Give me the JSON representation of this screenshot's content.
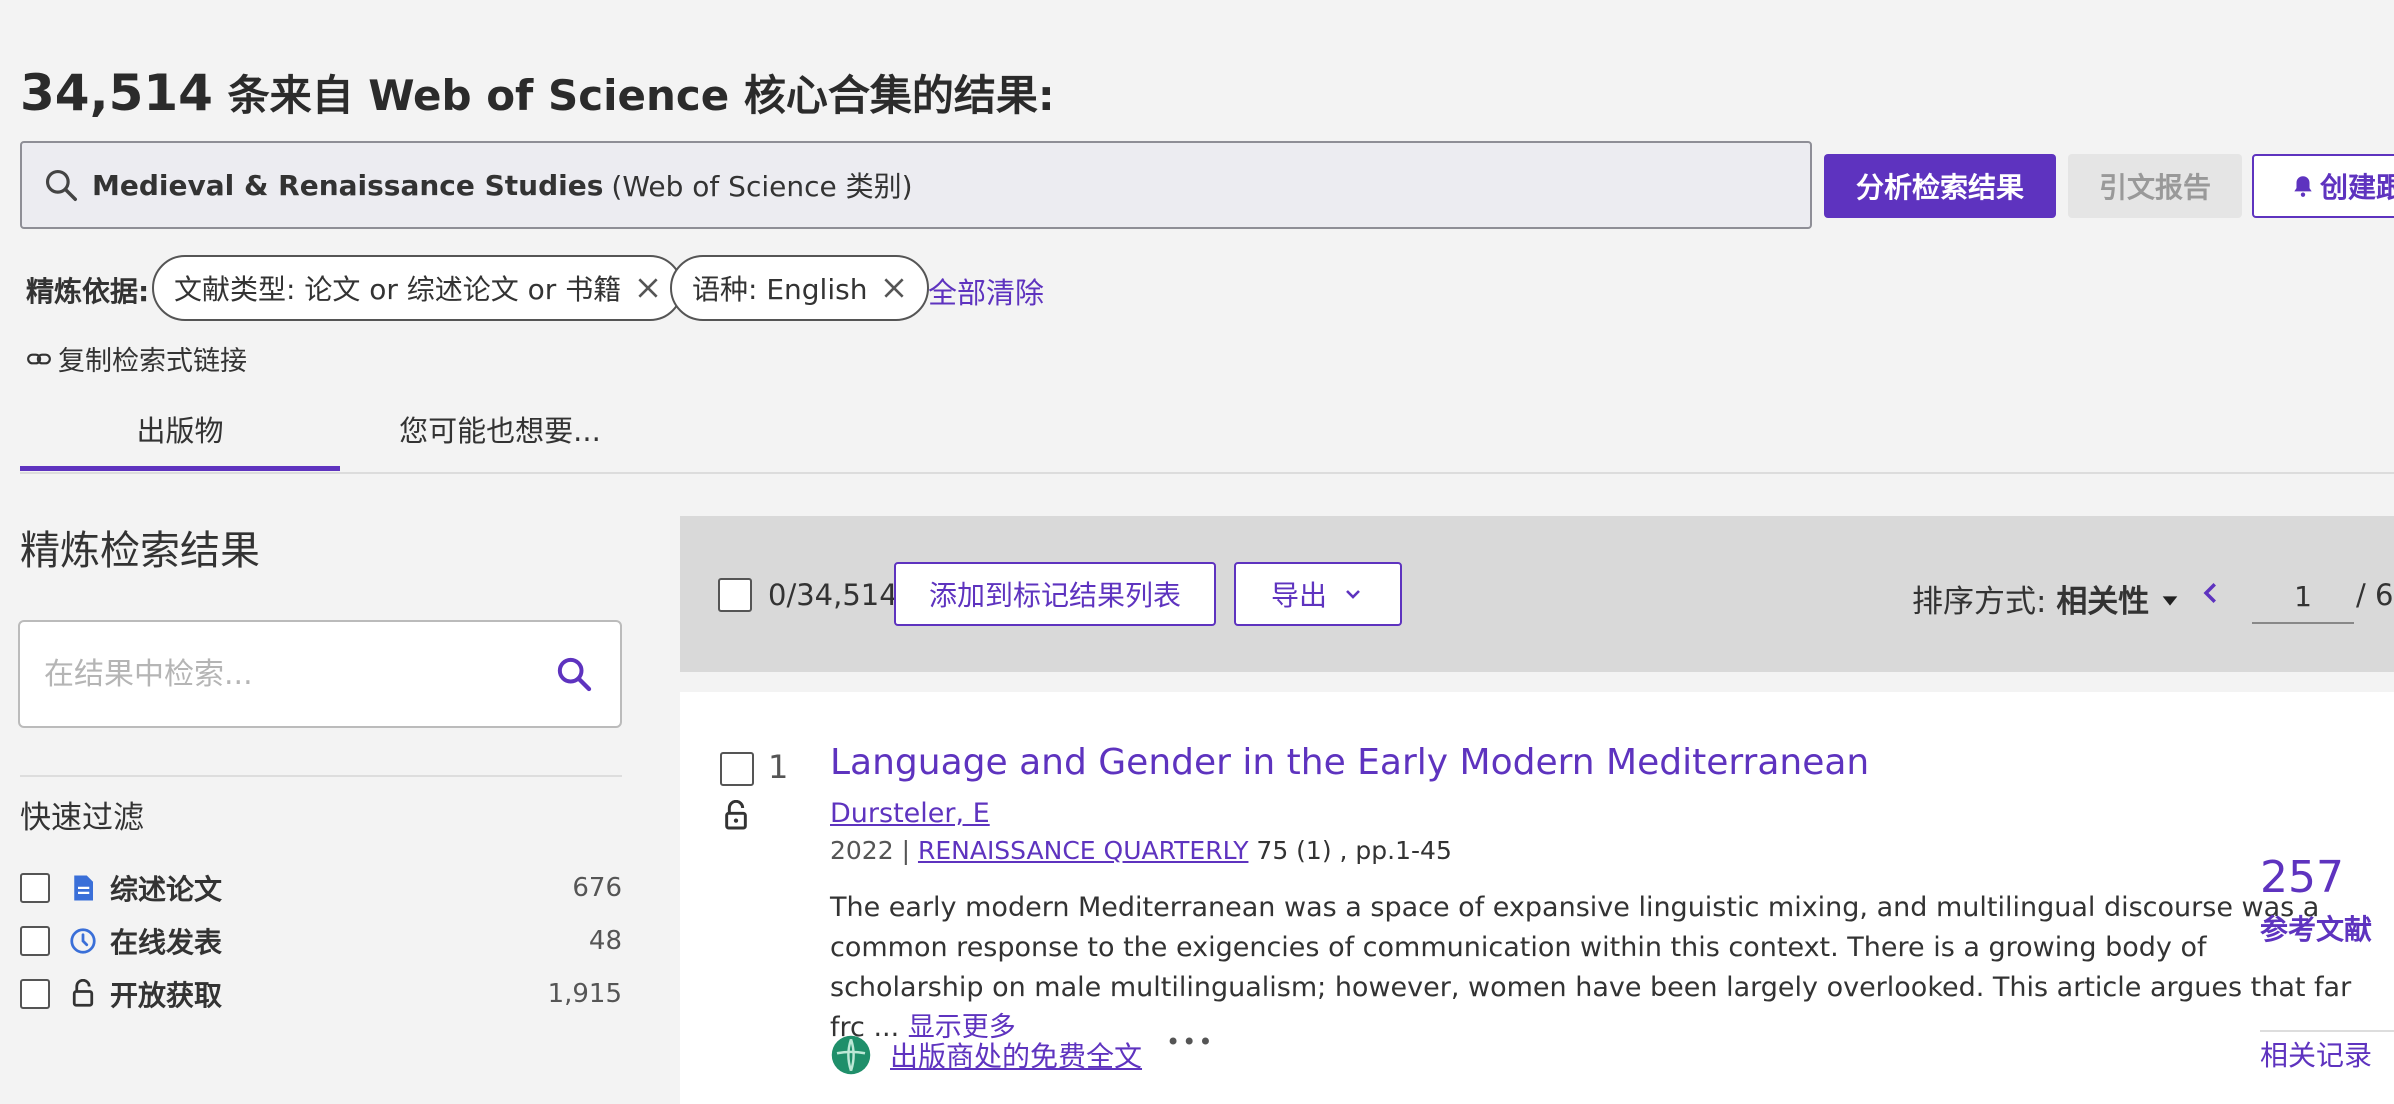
{
  "header": {
    "count": "34,514",
    "title_suffix": "条来自 Web of Science 核心合集的结果:"
  },
  "query": {
    "term": "Medieval & Renaissance Studies",
    "category": "(Web of Science 类别)"
  },
  "actions": {
    "analyze": "分析检索结果",
    "citation_report": "引文报告",
    "create_alert": "创建跟"
  },
  "refine": {
    "label": "精炼依据:",
    "chips": [
      {
        "text": "文献类型: 论文 or 综述论文 or 书籍"
      },
      {
        "text": "语种: English"
      }
    ],
    "clear_all": "全部清除"
  },
  "copy_link": "复制检索式链接",
  "tabs": [
    {
      "label": "出版物",
      "active": true
    },
    {
      "label": "您可能也想要..."
    }
  ],
  "sidebar": {
    "title": "精炼检索结果",
    "search_placeholder": "在结果中检索...",
    "quick_filter_title": "快速过滤",
    "filters": [
      {
        "label": "综述论文",
        "count": "676",
        "icon": "document-icon"
      },
      {
        "label": "在线发表",
        "count": "48",
        "icon": "clock-icon"
      },
      {
        "label": "开放获取",
        "count": "1,915",
        "icon": "open-lock-icon"
      }
    ]
  },
  "toolbar": {
    "selected": "0/34,514",
    "add_to_marked": "添加到标记结果列表",
    "export": "导出",
    "sort_label": "排序方式:",
    "sort_value": "相关性",
    "page_current": "1",
    "page_sep": "/ 6"
  },
  "results": [
    {
      "index": "1",
      "title": "Language and Gender in the Early Modern Mediterranean",
      "author": "Dursteler, E",
      "year": "2022",
      "journal": "RENAISSANCE QUARTERLY",
      "volume": "75 (1) , pp.1-45",
      "abstract": "The early modern Mediterranean was a space of expansive linguistic mixing, and multilingual discourse was a common response to the exigencies of communication within this context. There is a growing body of scholarship on male multilingualism; however, women have been largely overlooked. This article argues that far frc ...",
      "show_more": "显示更多",
      "full_text": "出版商处的免费全文",
      "more_menu": "•••",
      "references_count": "257",
      "references_label": "参考文献",
      "related_label": "相关记录"
    }
  ],
  "colors": {
    "accent": "#5e33bf",
    "background": "#f3f3f3",
    "toolbar": "#d9d9d9"
  }
}
